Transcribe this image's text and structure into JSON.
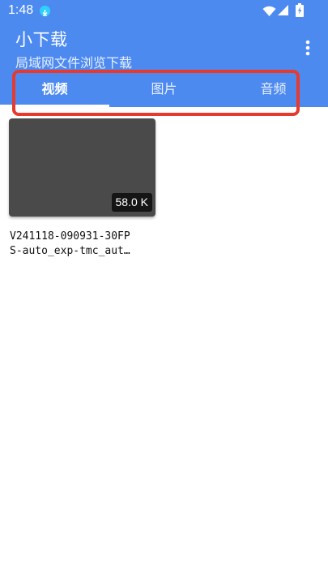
{
  "status_bar": {
    "time": "1:48",
    "icons": [
      "download-icon",
      "wifi-icon",
      "cellular-icon",
      "battery-charging-icon"
    ]
  },
  "app_bar": {
    "title": "小下载",
    "subtitle": "局域网文件浏览下载",
    "menu_icon": "more-vert-icon",
    "background": "#4d8af0"
  },
  "tabs": [
    {
      "label": "视频",
      "active": true
    },
    {
      "label": "图片",
      "active": false
    },
    {
      "label": "音频",
      "active": false
    }
  ],
  "annotation": {
    "highlight_color": "#e53a2d"
  },
  "files": [
    {
      "name_line_1": "V241118-090931-30FP",
      "name_line_2": "S-auto_exp-tmc_aut…",
      "size": "58.0 K",
      "thumbnail_color": "#4a4a4a"
    }
  ]
}
